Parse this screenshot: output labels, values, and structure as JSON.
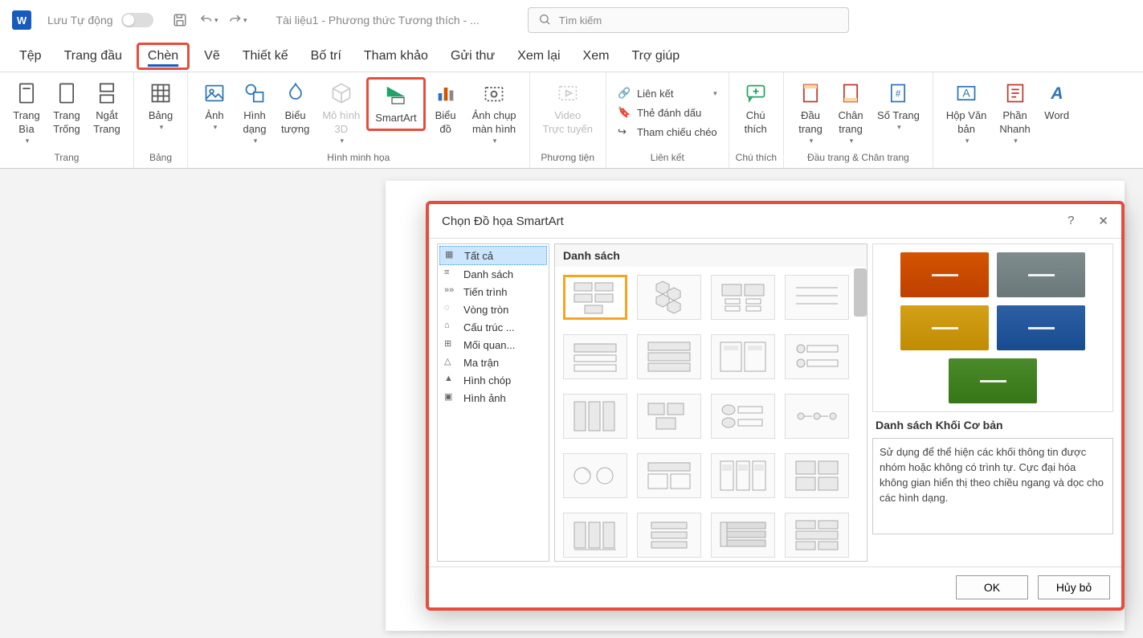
{
  "title_bar": {
    "app_icon": "W",
    "autosave": "Lưu Tự động",
    "doc_name": "Tài liệu1  -  Phương thức Tương thích  - ...",
    "search_placeholder": "Tìm kiếm"
  },
  "tabs": {
    "file": "Tệp",
    "home": "Trang đầu",
    "insert": "Chèn",
    "draw": "Vẽ",
    "design": "Thiết kế",
    "layout": "Bố trí",
    "references": "Tham khảo",
    "mailings": "Gửi thư",
    "review": "Xem lại",
    "view": "Xem",
    "help": "Trợ giúp"
  },
  "ribbon": {
    "groups": {
      "pages": {
        "label": "Trang",
        "cover": "Trang\nBìa",
        "blank": "Trang\nTrống",
        "break": "Ngắt\nTrang"
      },
      "tables": {
        "label": "Bảng",
        "table": "Bảng"
      },
      "illustrations": {
        "label": "Hình minh họa",
        "picture": "Ảnh",
        "shapes": "Hình\ndạng",
        "icons": "Biểu\ntượng",
        "model3d": "Mô hình\n3D",
        "smartart": "SmartArt",
        "chart": "Biểu\nđồ",
        "screenshot": "Ảnh chụp\nmàn hình"
      },
      "media": {
        "label": "Phương tiện",
        "video": "Video\nTrực tuyến"
      },
      "links": {
        "label": "Liên kết",
        "link": "Liên kết",
        "bookmark": "Thẻ đánh dấu",
        "crossref": "Tham chiếu chéo"
      },
      "comments": {
        "label": "Chú thích",
        "comment": "Chú\nthích"
      },
      "headerfooter": {
        "label": "Đầu trang & Chân trang",
        "header": "Đầu\ntrang",
        "footer": "Chân\ntrang",
        "pagenum": "Số Trang"
      },
      "text": {
        "label": "",
        "textbox": "Hộp Văn\nbản",
        "quickparts": "Phần\nNhanh",
        "wordart": "Word"
      }
    }
  },
  "dialog": {
    "title": "Chọn Đồ họa SmartArt",
    "categories": [
      {
        "icon": "▦",
        "label": "Tất cả",
        "selected": true
      },
      {
        "icon": "≡",
        "label": "Danh sách"
      },
      {
        "icon": "»»",
        "label": "Tiến trình"
      },
      {
        "icon": "◌",
        "label": "Vòng tròn"
      },
      {
        "icon": "⌂",
        "label": "Cấu trúc ..."
      },
      {
        "icon": "⊞",
        "label": "Mối quan..."
      },
      {
        "icon": "△",
        "label": "Ma trận"
      },
      {
        "icon": "▲",
        "label": "Hình chóp"
      },
      {
        "icon": "▣",
        "label": "Hình ảnh"
      }
    ],
    "gallery_header": "Danh sách",
    "preview": {
      "title": "Danh sách Khối Cơ bản",
      "desc": "Sử dụng để thể hiện các khối thông tin được nhóm hoặc không có trình tự. Cực đại hóa không gian hiển thị theo chiều ngang và dọc cho các hình dạng.",
      "colors": [
        "#d35400",
        "#7f8c8d",
        "#d4a017",
        "#2d5fa4",
        "#4a8a2a"
      ]
    },
    "buttons": {
      "ok": "OK",
      "cancel": "Hủy bỏ"
    }
  }
}
